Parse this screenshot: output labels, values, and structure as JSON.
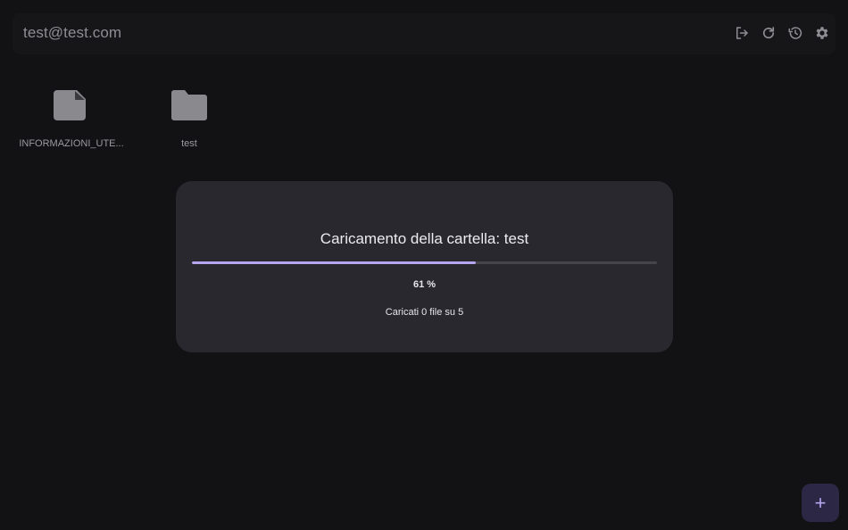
{
  "header": {
    "account": "test@test.com",
    "actions": [
      {
        "icon": "logout-icon"
      },
      {
        "icon": "refresh-icon"
      },
      {
        "icon": "history-icon"
      },
      {
        "icon": "settings-icon"
      }
    ]
  },
  "files": [
    {
      "name": "INFORMAZIONI_UTE...",
      "type": "file",
      "icon": "document-icon"
    },
    {
      "name": "test",
      "type": "folder",
      "icon": "folder-icon"
    }
  ],
  "upload_dialog": {
    "title": "Caricamento della cartella: test",
    "progress_percent": 61,
    "progress_label": "61 %",
    "status": "Caricati 0 file su 5"
  },
  "fab": {
    "icon": "plus-icon",
    "label": "+"
  },
  "colors": {
    "background": "#121214",
    "dialog": "#29282f",
    "accent": "#b5a6ef",
    "icon": "#8e8e94"
  }
}
